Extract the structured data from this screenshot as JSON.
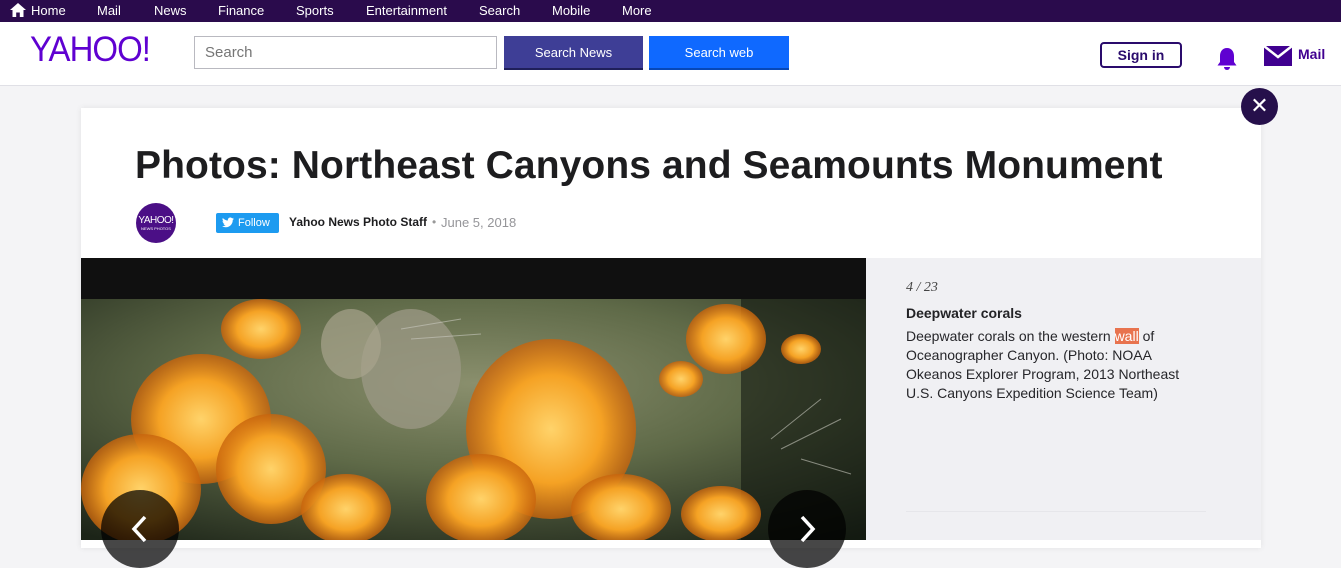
{
  "topnav": {
    "items": [
      "Home",
      "Mail",
      "News",
      "Finance",
      "Sports",
      "Entertainment",
      "Search",
      "Mobile",
      "More"
    ]
  },
  "header": {
    "logo": "YAHOO!",
    "search_placeholder": "Search",
    "search_news_label": "Search News",
    "search_web_label": "Search web",
    "signin_label": "Sign in",
    "mail_label": "Mail"
  },
  "article": {
    "title": "Photos: Northeast Canyons and Seamounts Monument",
    "avatar_text": "YAHOO!",
    "avatar_sub": "NEWS PHOTOS",
    "follow_label": "Follow",
    "author": "Yahoo News Photo Staff",
    "separator": "•",
    "date": "June 5, 2018"
  },
  "slideshow": {
    "counter": "4 / 23",
    "caption_title": "Deepwater corals",
    "caption_before": "Deepwater corals on the western ",
    "caption_highlight": "wall",
    "caption_after": " of Oceanographer Canyon. (Photo: NOAA Okeanos Explorer Program, 2013 Northeast U.S. Canyons Expedition Science Team)"
  },
  "colors": {
    "topnav_bg": "#2a0b4c",
    "brand_purple": "#5f01d1",
    "search_news_bg": "#3e3e96",
    "search_web_bg": "#0f69ff",
    "highlight": "#e8734e"
  }
}
